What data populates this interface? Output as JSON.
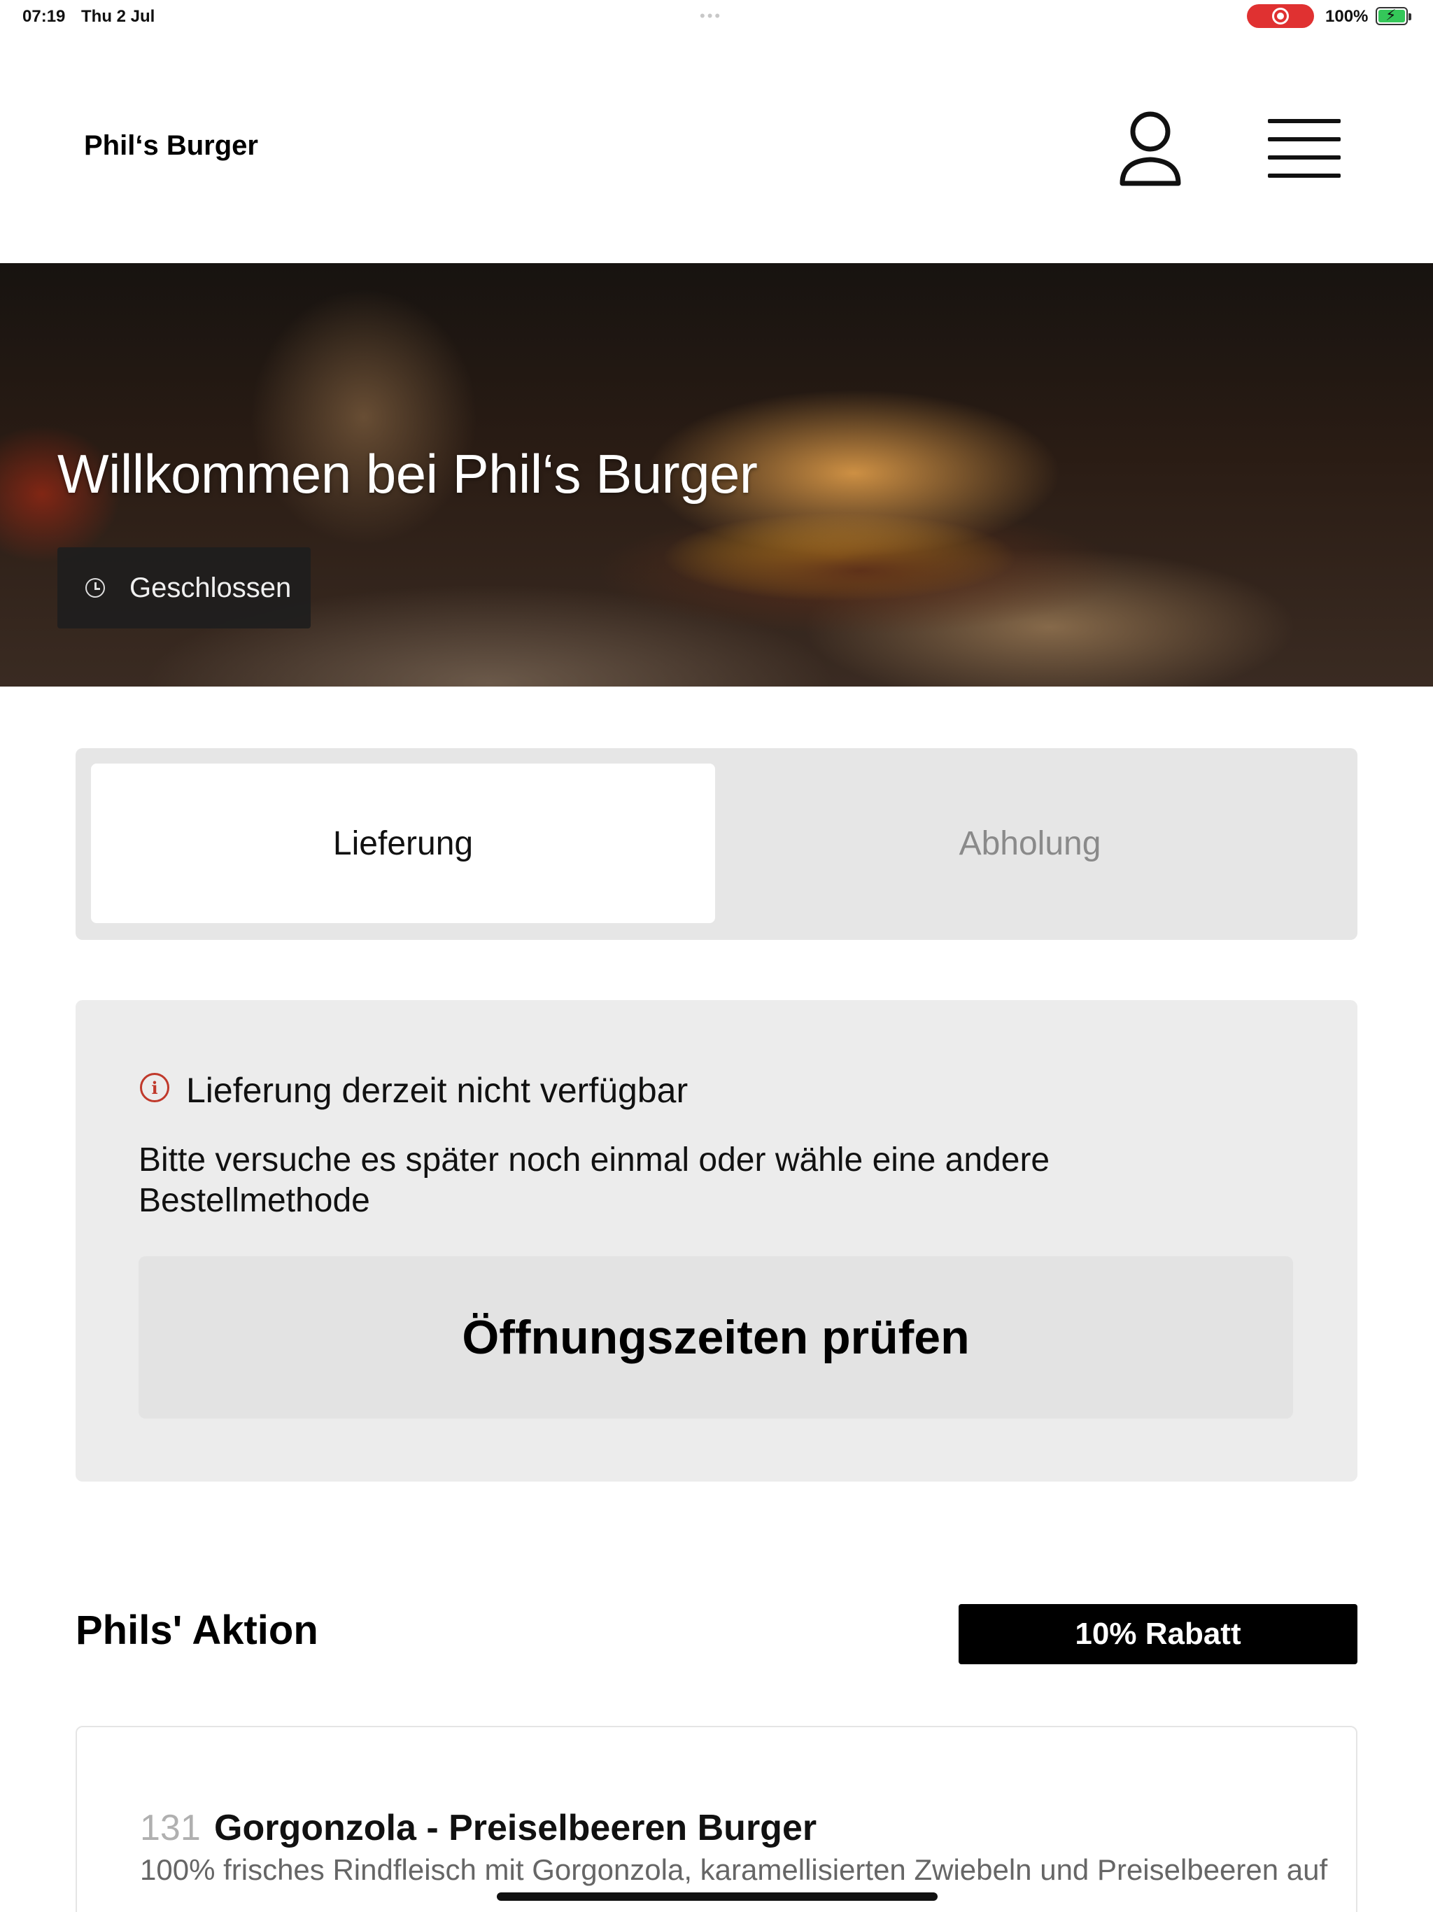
{
  "status_bar": {
    "time": "07:19",
    "date": "Thu 2 Jul",
    "battery_percent": "100%",
    "recording_color": "#e03131",
    "battery_level": 1.0
  },
  "header": {
    "brand": "Phil‘s Burger",
    "user_icon": "user-icon",
    "menu_icon": "hamburger-menu-icon"
  },
  "hero": {
    "title": "Willkommen bei Phil‘s Burger",
    "status_label": "Geschlossen",
    "status_icon": "clock-icon"
  },
  "order_tabs": [
    {
      "label": "Lieferung",
      "active": true
    },
    {
      "label": "Abholung",
      "active": false
    }
  ],
  "notice": {
    "icon": "info-icon",
    "icon_color": "#c0392b",
    "title": "Lieferung derzeit nicht verfügbar",
    "text": "Bitte versuche es später noch einmal oder wähle eine andere Bestellmethode",
    "button_label": "Öffnungszeiten prüfen"
  },
  "promotion": {
    "title": "Phils' Aktion",
    "badge": "10% Rabatt"
  },
  "products": [
    {
      "number": "131",
      "name": "Gorgonzola - Preiselbeeren Burger",
      "description": "100% frisches Rindfleisch mit Gorgonzola, karamellisierten Zwiebeln und Preiselbeeren auf"
    }
  ]
}
